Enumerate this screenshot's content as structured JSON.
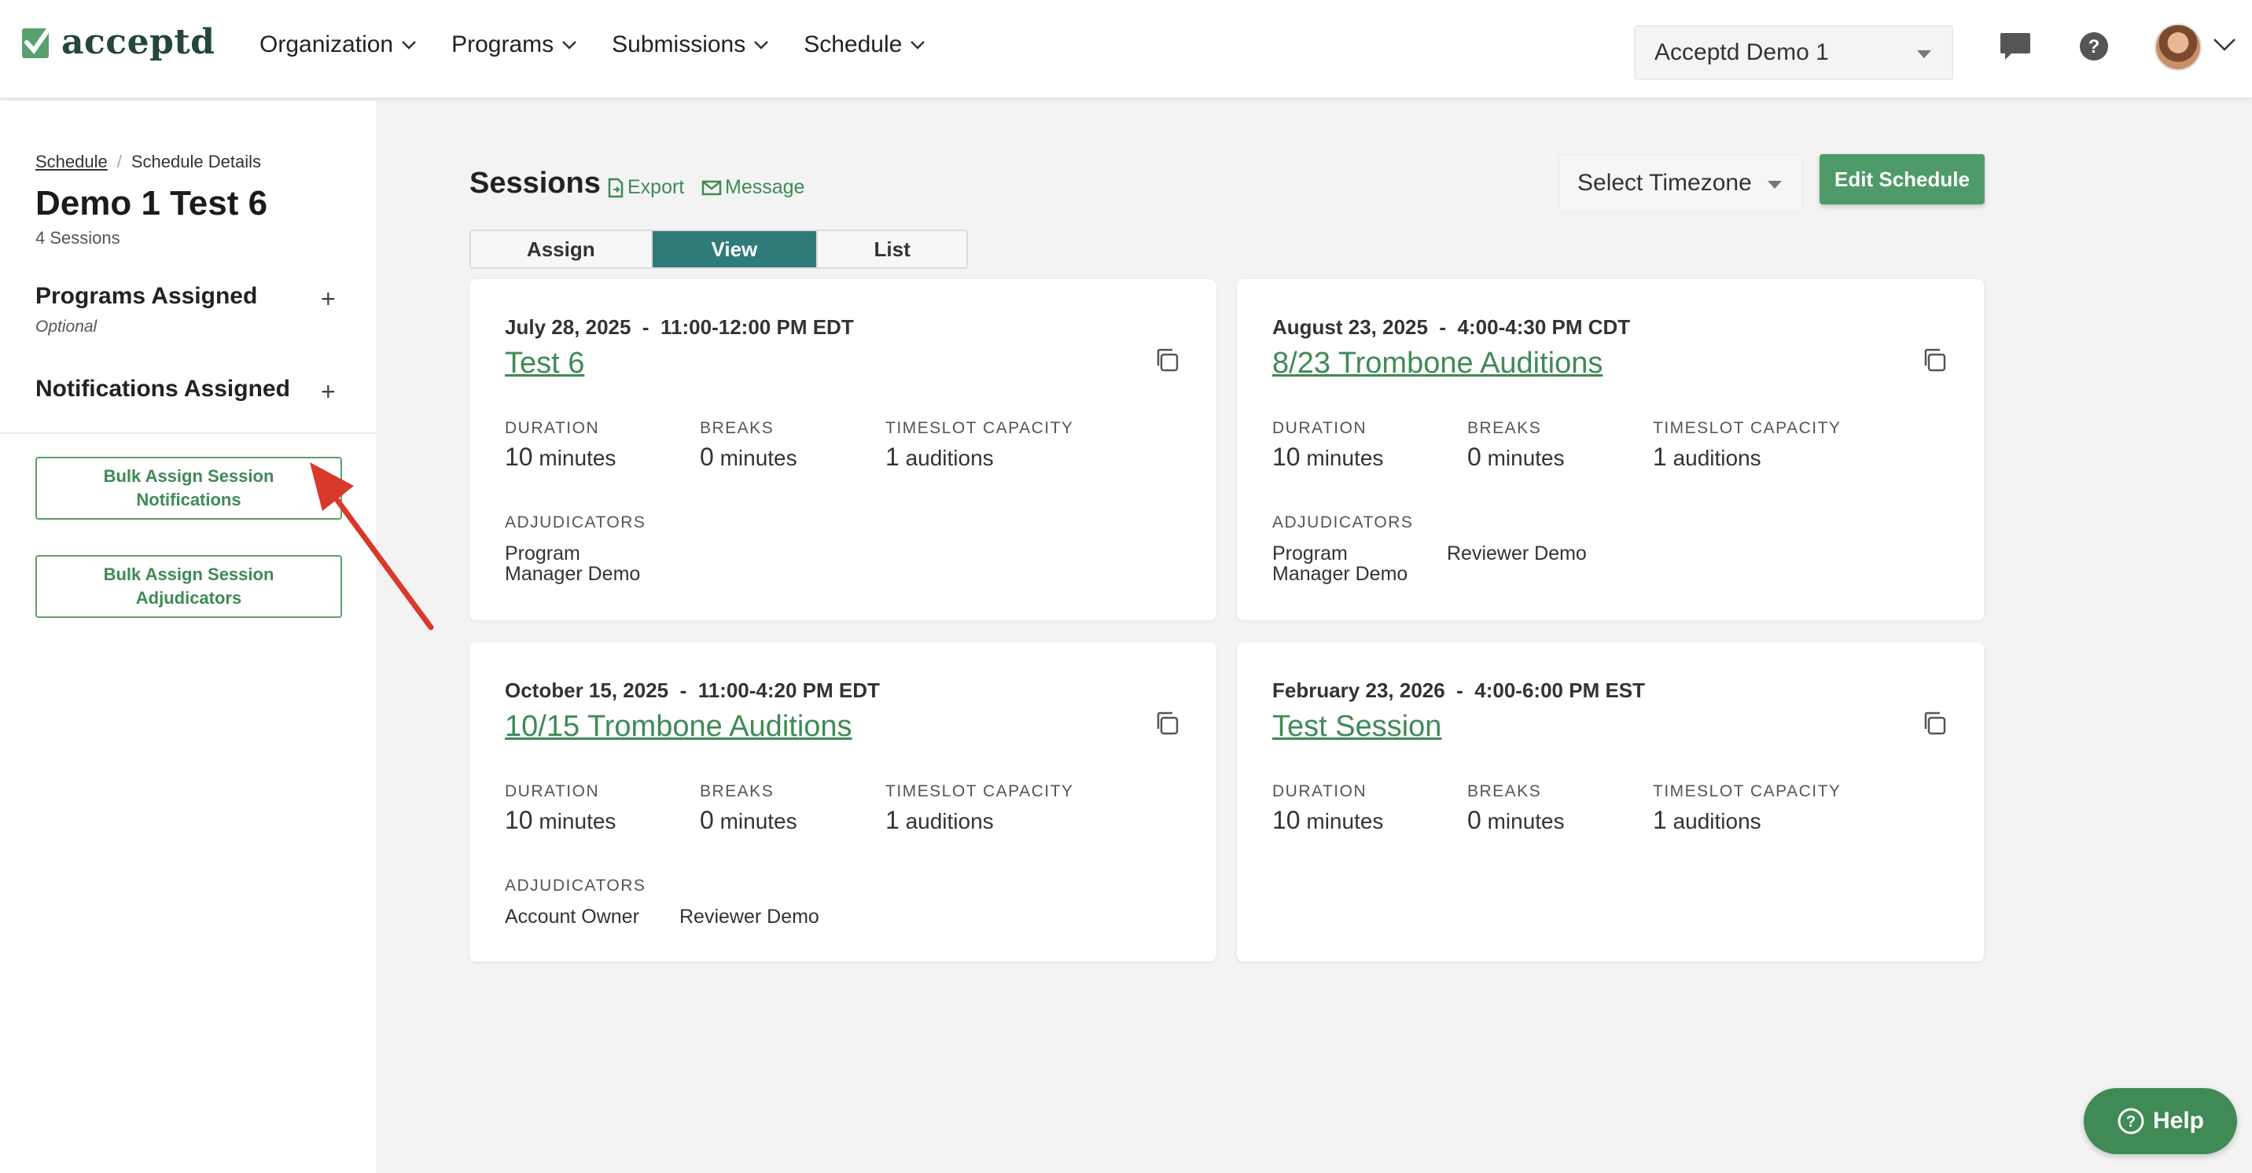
{
  "header": {
    "logo_text": "acceptd",
    "nav": [
      {
        "label": "Organization"
      },
      {
        "label": "Programs"
      },
      {
        "label": "Submissions"
      },
      {
        "label": "Schedule"
      }
    ],
    "org_select_value": "Acceptd Demo 1"
  },
  "sidebar": {
    "breadcrumb_link": "Schedule",
    "breadcrumb_separator": "/",
    "breadcrumb_current": "Schedule Details",
    "title": "Demo 1 Test 6",
    "session_count": "4 Sessions",
    "programs_label": "Programs Assigned",
    "programs_sub": "Optional",
    "notifications_label": "Notifications Assigned",
    "plus": "+",
    "bulk_notifications": "Bulk Assign Session Notifications",
    "bulk_adjudicators": "Bulk Assign Session Adjudicators"
  },
  "main": {
    "title": "Sessions",
    "export_label": "Export",
    "message_label": "Message",
    "timezone_placeholder": "Select Timezone",
    "edit_label": "Edit Schedule",
    "tabs": [
      {
        "label": "Assign"
      },
      {
        "label": "View"
      },
      {
        "label": "List"
      }
    ],
    "labels": {
      "duration": "DURATION",
      "breaks": "BREAKS",
      "capacity": "TIMESLOT CAPACITY",
      "adjudicators": "ADJUDICATORS"
    },
    "sessions": [
      {
        "date": "July 28, 2025",
        "time": "11:00-12:00 PM EDT",
        "name": "Test 6",
        "duration_num": "10",
        "duration_unit": "minutes",
        "breaks_num": "0",
        "breaks_unit": "minutes",
        "capacity_num": "1",
        "capacity_unit": "auditions",
        "adjudicators": [
          "Program\nManager Demo"
        ]
      },
      {
        "date": "August 23, 2025",
        "time": "4:00-4:30 PM CDT",
        "name": "8/23 Trombone Auditions",
        "duration_num": "10",
        "duration_unit": "minutes",
        "breaks_num": "0",
        "breaks_unit": "minutes",
        "capacity_num": "1",
        "capacity_unit": "auditions",
        "adjudicators": [
          "Program\nManager Demo",
          "Reviewer Demo"
        ]
      },
      {
        "date": "October 15, 2025",
        "time": "11:00-4:20 PM EDT",
        "name": "10/15 Trombone Auditions",
        "duration_num": "10",
        "duration_unit": "minutes",
        "breaks_num": "0",
        "breaks_unit": "minutes",
        "capacity_num": "1",
        "capacity_unit": "auditions",
        "adjudicators": [
          "Account Owner",
          "Reviewer Demo"
        ]
      },
      {
        "date": "February 23, 2026",
        "time": "4:00-6:00 PM EST",
        "name": "Test Session",
        "duration_num": "10",
        "duration_unit": "minutes",
        "breaks_num": "0",
        "breaks_unit": "minutes",
        "capacity_num": "1",
        "capacity_unit": "auditions",
        "adjudicators": []
      }
    ]
  },
  "help_label": "Help",
  "colors": {
    "brand_green": "#3f8a55",
    "active_tab": "#2f7b7a",
    "arrow_red": "#d9392b"
  }
}
